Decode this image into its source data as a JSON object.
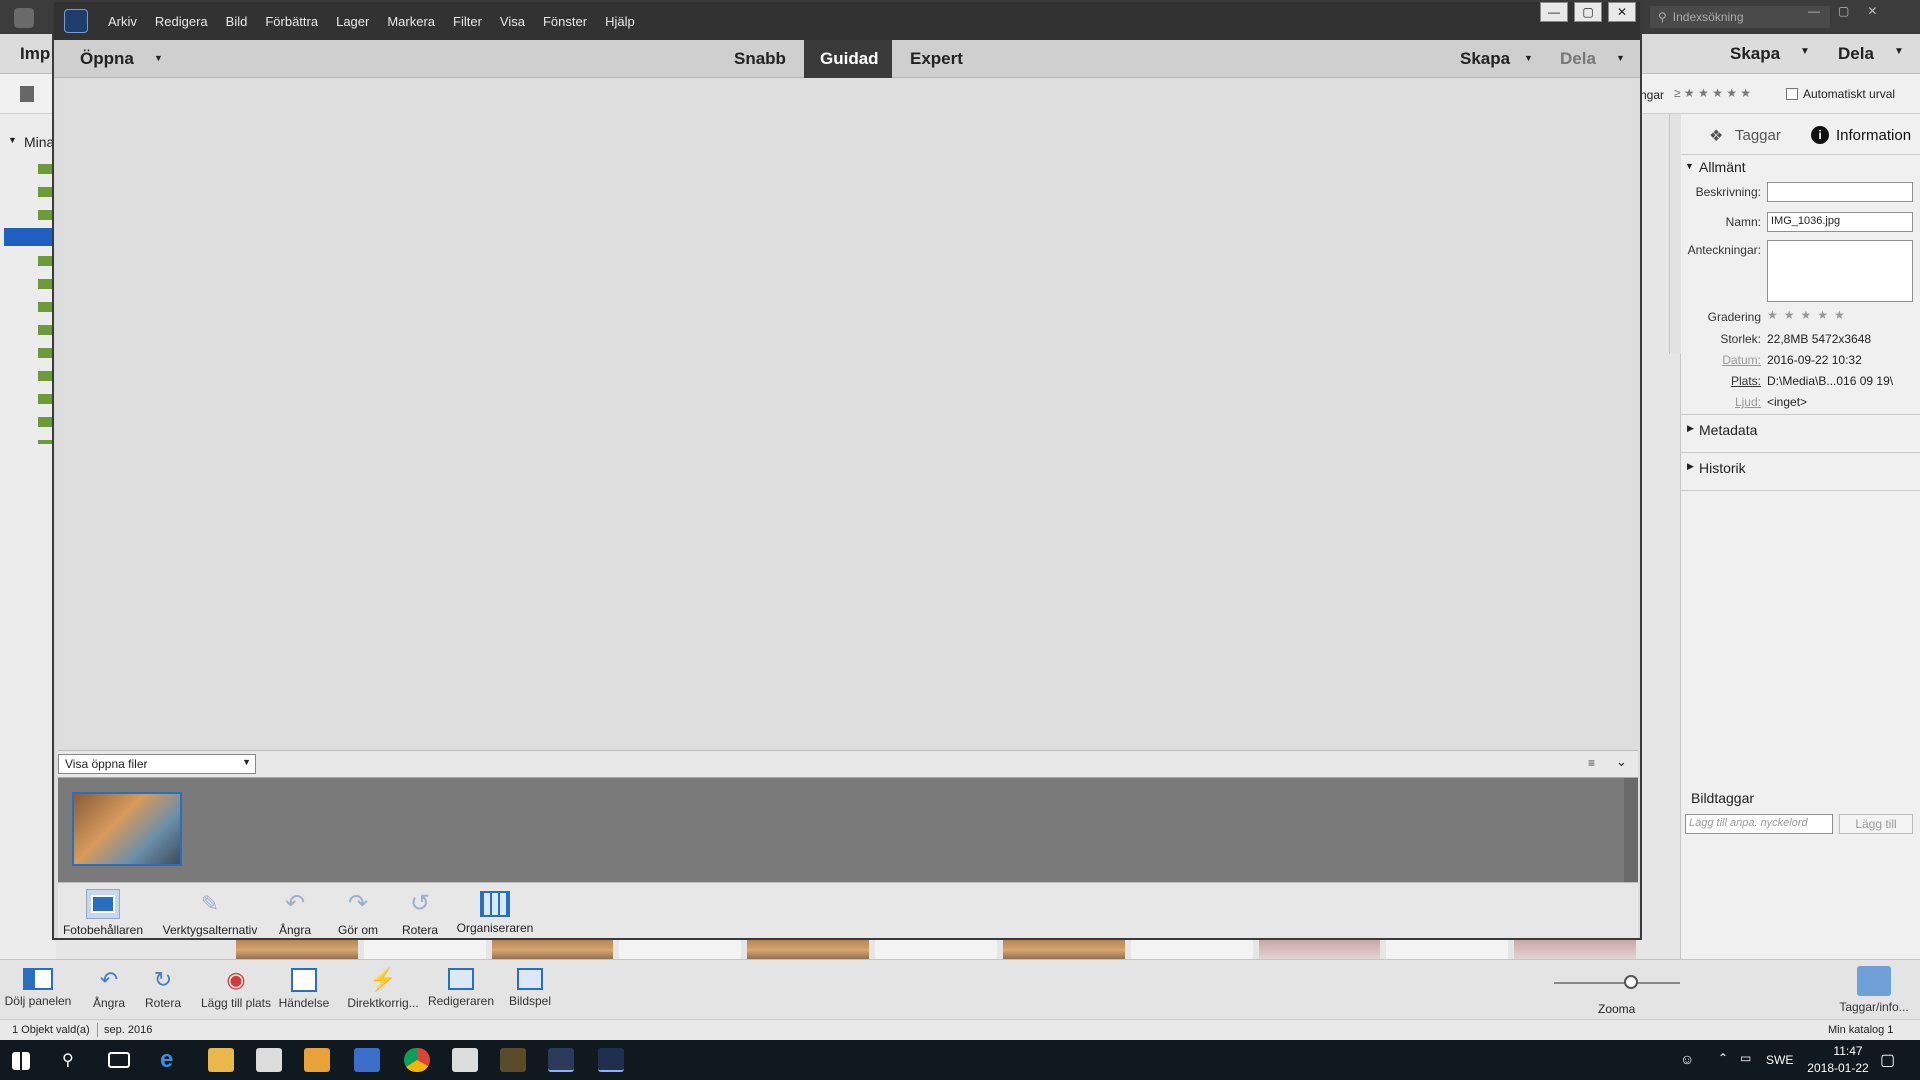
{
  "organizer": {
    "search_placeholder": "Indexsökning",
    "left_truncated_label": "Imp",
    "tree_label": "Mina",
    "right_menu": {
      "skapa": "Skapa",
      "dela": "Dela"
    },
    "filter_truncated": "ngar",
    "auto_select_label": "Automatiskt urval",
    "panel_tabs": {
      "tags": "Taggar",
      "info": "Information"
    },
    "general_section": "Allmänt",
    "fields": {
      "description_label": "Beskrivning:",
      "description_value": "",
      "name_label": "Namn:",
      "name_value": "IMG_1036.jpg",
      "notes_label": "Anteckningar:",
      "rating_label": "Gradering",
      "size_label": "Storlek:",
      "size_value": "22,8MB  5472x3648",
      "date_label": "Datum:",
      "date_value": "2016-09-22 10:32",
      "place_label": "Plats:",
      "place_value": "D:\\Media\\B...016 09 19\\",
      "sound_label": "Ljud:",
      "sound_value": "<inget>"
    },
    "metadata_section": "Metadata",
    "history_section": "Historik",
    "image_tags_label": "Bildtaggar",
    "tag_input_placeholder": "Lägg till anpa. nyckelord",
    "add_button": "Lägg till",
    "bottom_buttons": {
      "hide_panel": "Dölj panelen",
      "undo": "Ångra",
      "rotate": "Rotera",
      "add_place": "Lägg till plats",
      "event": "Händelse",
      "quick_fix": "Direktkorrig...",
      "editor": "Redigeraren",
      "slideshow": "Bildspel",
      "zoom": "Zooma",
      "tags_info": "Taggar/info..."
    },
    "status_left": "1 Objekt vald(a)",
    "status_date": "sep. 2016",
    "status_right": "Min katalog 1"
  },
  "editor": {
    "menu": [
      "Arkiv",
      "Redigera",
      "Bild",
      "Förbättra",
      "Lager",
      "Markera",
      "Filter",
      "Visa",
      "Fönster",
      "Hjälp"
    ],
    "open_label": "Öppna",
    "modes": {
      "quick": "Snabb",
      "guided": "Guidad",
      "expert": "Expert"
    },
    "create_label": "Skapa",
    "share_label": "Dela",
    "bin_select": "Visa öppna filer",
    "tools": {
      "photo_bin": "Fotobehållaren",
      "tool_options": "Verktygsalternativ",
      "undo": "Ångra",
      "redo": "Gör om",
      "rotate": "Rotera",
      "organizer": "Organiseraren"
    }
  },
  "taskbar": {
    "language": "SWE",
    "time": "11:47",
    "date": "2018-01-22"
  },
  "colors": {
    "active_mode_bg": "#3a3a3a",
    "accent_blue": "#2a6fbf"
  }
}
